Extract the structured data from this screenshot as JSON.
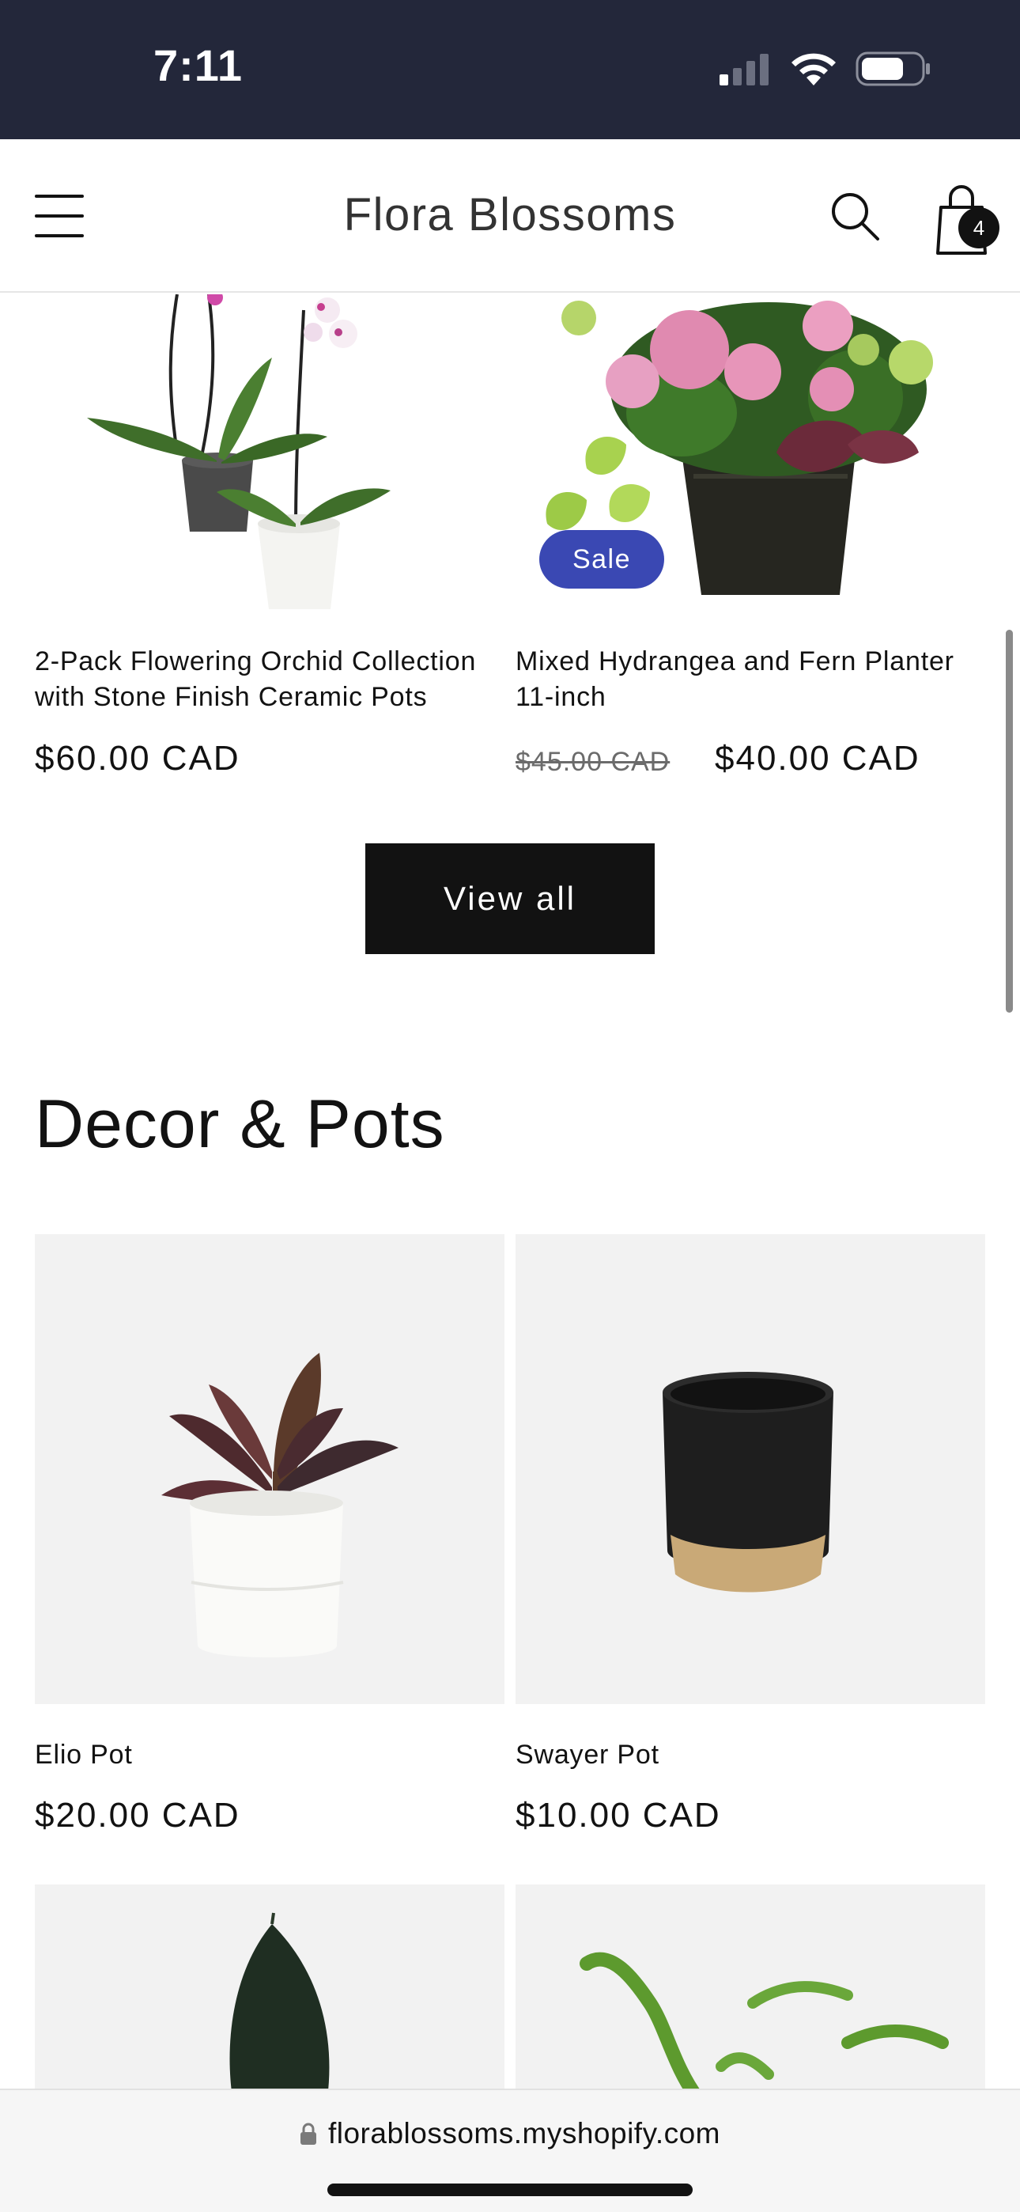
{
  "status_bar": {
    "time": "7:11"
  },
  "header": {
    "brand": "Flora Blossoms",
    "cart_count": "4"
  },
  "featured_products": [
    {
      "title_line1": "2-Pack Flowering Orchid Collection",
      "title_line2": "with Stone Finish Ceramic Pots",
      "price": "$60.00 CAD"
    },
    {
      "title_line1": "Mixed Hydrangea and Fern Planter",
      "title_line2": "11-inch",
      "badge": "Sale",
      "compare_price": "$45.00 CAD",
      "price": "$40.00 CAD"
    }
  ],
  "view_all_label": "View all",
  "decor_section": {
    "title": "Decor & Pots",
    "products": [
      {
        "title": "Elio Pot",
        "price": "$20.00 CAD"
      },
      {
        "title": "Swayer Pot",
        "price": "$10.00 CAD"
      }
    ]
  },
  "url_bar": {
    "url": "florablossoms.myshopify.com"
  },
  "colors": {
    "status_bar_bg": "#23273a",
    "sale_badge": "#3a48b3",
    "button_bg": "#121212",
    "tile_bg": "#f2f2f2"
  }
}
